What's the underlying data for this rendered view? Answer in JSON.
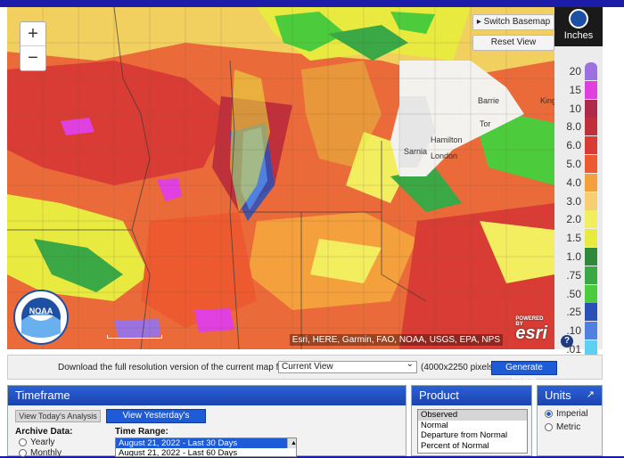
{
  "map": {
    "buttons": {
      "switch_basemap": "Switch Basemap",
      "reset_view": "Reset View"
    },
    "zoom": {
      "in": "+",
      "out": "−"
    },
    "places": [
      "Barrie",
      "King",
      "Tor",
      "Hamilton",
      "London",
      "Sarnia"
    ],
    "attribution": "Esri, HERE, Garmin, FAO, NOAA, USGS, EPA, NPS",
    "esri_logo": "esri",
    "esri_powered": "POWERED BY",
    "noaa_logo_text": "NOAA"
  },
  "legend": {
    "title": "Inches",
    "help": "?",
    "levels": [
      {
        "label": "20",
        "color": "#9b72e0"
      },
      {
        "label": "15",
        "color": "#e040e0"
      },
      {
        "label": "10",
        "color": "#b0284a"
      },
      {
        "label": "8.0",
        "color": "#c0303a"
      },
      {
        "label": "6.0",
        "color": "#d83c34"
      },
      {
        "label": "5.0",
        "color": "#ee5a30"
      },
      {
        "label": "4.0",
        "color": "#f4a03c"
      },
      {
        "label": "3.0",
        "color": "#f6d070"
      },
      {
        "label": "2.0",
        "color": "#f2ee60"
      },
      {
        "label": "1.5",
        "color": "#e8ea40"
      },
      {
        "label": "1.0",
        "color": "#2e8a3a"
      },
      {
        "label": ".75",
        "color": "#3aa844"
      },
      {
        "label": ".50",
        "color": "#4ccc3c"
      },
      {
        "label": ".25",
        "color": "#2a50b8"
      },
      {
        "label": ".10",
        "color": "#5080e0"
      },
      {
        "label": ".01",
        "color": "#5cd0f0"
      },
      {
        "label": "",
        "color": "#909090"
      }
    ]
  },
  "download": {
    "text": "Download the full resolution version of the current map for",
    "selected": "Current View",
    "pixels": "(4000x2250 pixels)",
    "button": "Generate Image"
  },
  "timeframe": {
    "title": "Timeframe",
    "today_btn": "View Today's Analysis",
    "yesterday_btn": "View Yesterday's Analysis",
    "archive_label": "Archive Data:",
    "archive_options": [
      "Yearly",
      "Monthly"
    ],
    "range_label": "Time Range:",
    "ranges": [
      "August 21, 2022 - Last 30 Days",
      "August 21, 2022 - Last 60 Days"
    ]
  },
  "product": {
    "title": "Product",
    "options": [
      "Observed",
      "Normal",
      "Departure from Normal",
      "Percent of Normal"
    ]
  },
  "units": {
    "title": "Units",
    "expand_icon": "↗",
    "options": [
      "Imperial",
      "Metric"
    ]
  }
}
